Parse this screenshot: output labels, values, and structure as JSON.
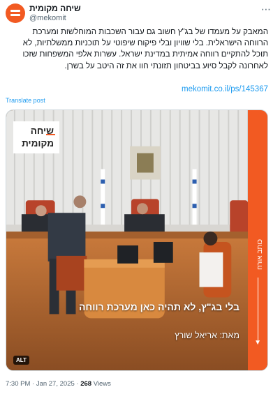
{
  "account": {
    "display_name": "שיחה מקומית",
    "handle": "@mekomit"
  },
  "tweet": {
    "text": "המאבק על מעמדו של בג\"ץ חשוב גם עבור השכבות המוחלשות ומערכת הרווחה הישראלית. בלי שוויון ובלי פיקוח שיפוטי על תוכניות ממשלתיות, לא תוכל להתקיים רווחה אמיתית במדינת ישראל. עשרות אלפי המשפחות שזכו לאחרונה לקבל סיוע בביטחון תזונתי חוו את זה היטב על בשרן.",
    "link": "mekomit.co.il/ps/145367",
    "translate_label": "Translate post"
  },
  "media": {
    "logo_line1": "שיחה",
    "logo_line2": "מקומית",
    "side_label": "כותב אורח",
    "overlay_title": "בלי בג\"ץ, לא תהיה כאן מערכת רווחה",
    "overlay_author": "מאת: אריאל שורץ",
    "alt_badge": "ALT",
    "accent_color": "#f25a22"
  },
  "footer": {
    "timestamp": "7:30 PM · Jan 27, 2025 · ",
    "views_count": "268",
    "views_label": " Views"
  },
  "icons": {
    "more": "more-options-icon",
    "down_arrow": "down-arrow-icon"
  }
}
